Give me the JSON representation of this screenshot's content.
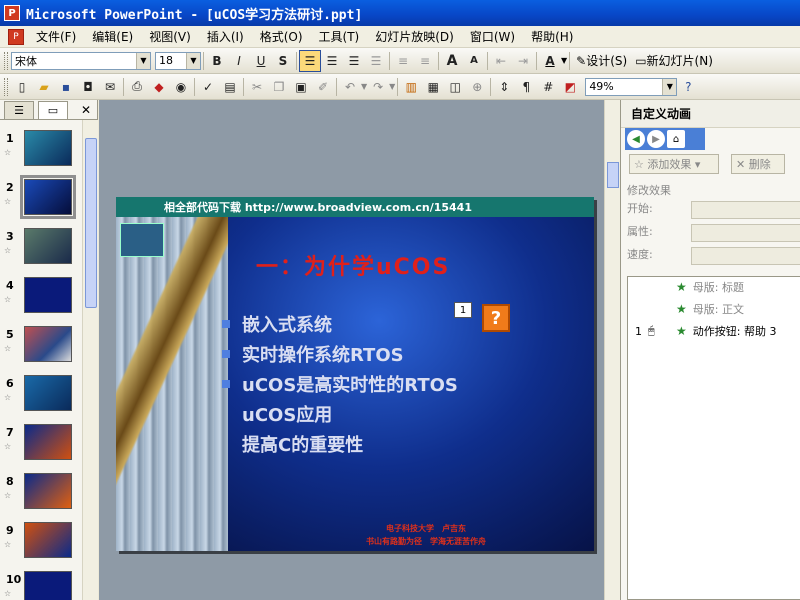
{
  "window": {
    "title": "Microsoft PowerPoint - [uCOS学习方法研讨.ppt]"
  },
  "menu": [
    "文件(F)",
    "编辑(E)",
    "视图(V)",
    "插入(I)",
    "格式(O)",
    "工具(T)",
    "幻灯片放映(D)",
    "窗口(W)",
    "帮助(H)"
  ],
  "format_toolbar": {
    "font": "宋体",
    "size": "18",
    "bold": "B",
    "italic": "I",
    "underline": "U",
    "shadow": "S",
    "grow": "A",
    "shrink": "A",
    "design": "设计(S)",
    "new_slide": "新幻灯片(N)"
  },
  "standard_toolbar": {
    "zoom": "49%"
  },
  "slides_pane": {
    "numbers": [
      "1",
      "2",
      "3",
      "4",
      "5",
      "6",
      "7",
      "8",
      "9",
      "10"
    ],
    "selected": 2
  },
  "slide": {
    "banner": "相全部代码下载 http://www.broadview.com.cn/15441",
    "title": "一：为什学uCOS",
    "bullets": [
      "嵌入式系统",
      "实时操作系统RTOS",
      "uCOS是高实时性的RTOS",
      "uCOS应用",
      "提高C的重要性"
    ],
    "tag_number": "1",
    "question_button": "?",
    "footer_line1": "电子科技大学　卢吉东",
    "footer_line2": "书山有路勤为径　学海无涯苦作舟"
  },
  "task_pane": {
    "title": "自定义动画",
    "add_effect": "添加效果",
    "delete": "删除",
    "modify_label": "修改效果",
    "start_label": "开始:",
    "property_label": "属性:",
    "speed_label": "速度:",
    "items": [
      {
        "num": "",
        "name": "母版: 标题"
      },
      {
        "num": "",
        "name": "母版: 正文"
      },
      {
        "num": "1",
        "name": "动作按钮: 帮助 3"
      }
    ]
  }
}
